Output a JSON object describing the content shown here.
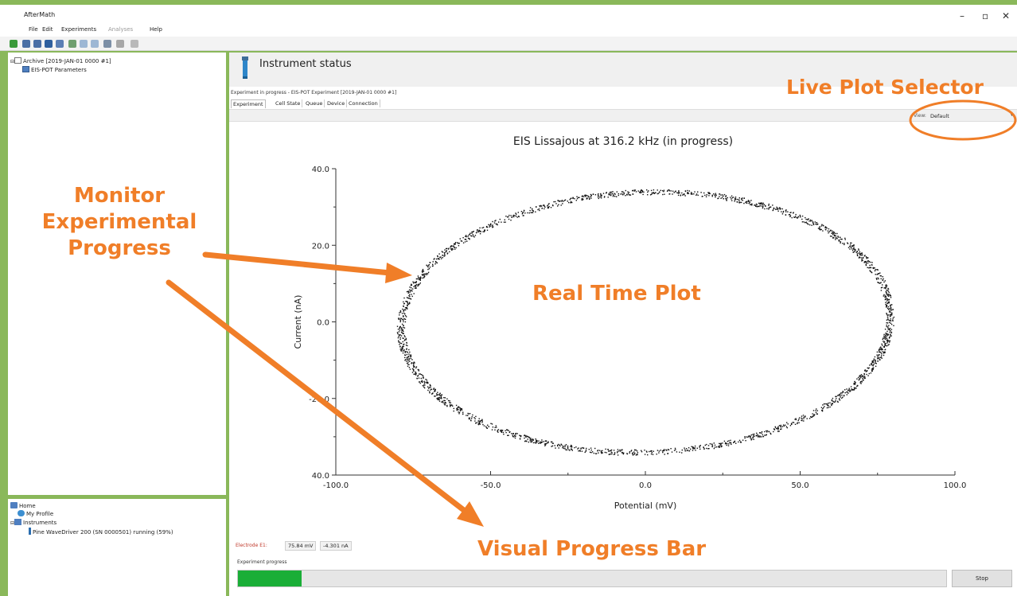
{
  "window": {
    "title": "AfterMath",
    "controls": {
      "minimize": "–",
      "maximize": "▫",
      "close": "✕"
    }
  },
  "menu": {
    "items": [
      "File",
      "Edit",
      "Experiments",
      "Analyses",
      "Help"
    ]
  },
  "toolbar": {
    "icons": [
      "new-icon",
      "open-icon",
      "import-icon",
      "save-icon",
      "print-icon",
      "chart-icon",
      "copy-icon",
      "paste-icon",
      "settings-icon",
      "tools-icon",
      "help-icon"
    ]
  },
  "archive_tree": {
    "archive_label": "Archive [2019-JAN-01 0000 #1]",
    "child_label": "EIS-POT Parameters"
  },
  "home_tree": {
    "home": "Home",
    "profile": "My Profile",
    "instruments": "Instruments",
    "instrument": "Pine WaveDriver 200 (SN 0000501) running (59%)"
  },
  "instrument_status": {
    "title": "Instrument status",
    "experiment_line": "Experiment in progress - EIS-POT Experiment [2019-JAN-01 0000 #1]",
    "tabs": [
      "Experiment",
      "Cell State",
      "Queue",
      "Device",
      "Connection"
    ],
    "active_tab": 0,
    "view_label": "View:",
    "view_value": "Default"
  },
  "chart_data": {
    "type": "scatter",
    "title": "EIS Lissajous at 316.2 kHz (in progress)",
    "xlabel": "Potential (mV)",
    "ylabel": "Current (nA)",
    "xlim": [
      -100,
      100
    ],
    "ylim": [
      -40,
      40
    ],
    "xticks": [
      -100,
      -50,
      0,
      50,
      100
    ],
    "xtick_labels": [
      "-100.0",
      "-50.0",
      "0.0",
      "50.0",
      "100.0"
    ],
    "yticks": [
      40,
      20,
      0,
      -20,
      -40
    ],
    "ytick_labels": [
      "40.0",
      "20.0",
      "0.0",
      "-20.0",
      "40.0"
    ],
    "series": [
      {
        "shape": "ellipse",
        "center": [
          0,
          0
        ],
        "x_amplitude": 79,
        "y_amplitude": 34,
        "y_peak_x": 10,
        "point_count": 2200,
        "color": "#111111"
      }
    ]
  },
  "status_bar": {
    "electrode_label": "Electrode E1:",
    "potential": "75.84 mV",
    "current": "-4.301 nA",
    "progress_label": "Experiment progress",
    "progress_value": 0.09,
    "stop_label": "Stop",
    "progress_color": "#1aae37"
  },
  "annotations": {
    "monitor_line1": "Monitor",
    "monitor_line2": "Experimental",
    "monitor_line3": "Progress",
    "real_time": "Real Time Plot",
    "live_selector": "Live Plot Selector",
    "progress_bar": "Visual Progress Bar",
    "color": "#f07e28"
  },
  "colors": {
    "frame_green": "#8ab85a"
  }
}
